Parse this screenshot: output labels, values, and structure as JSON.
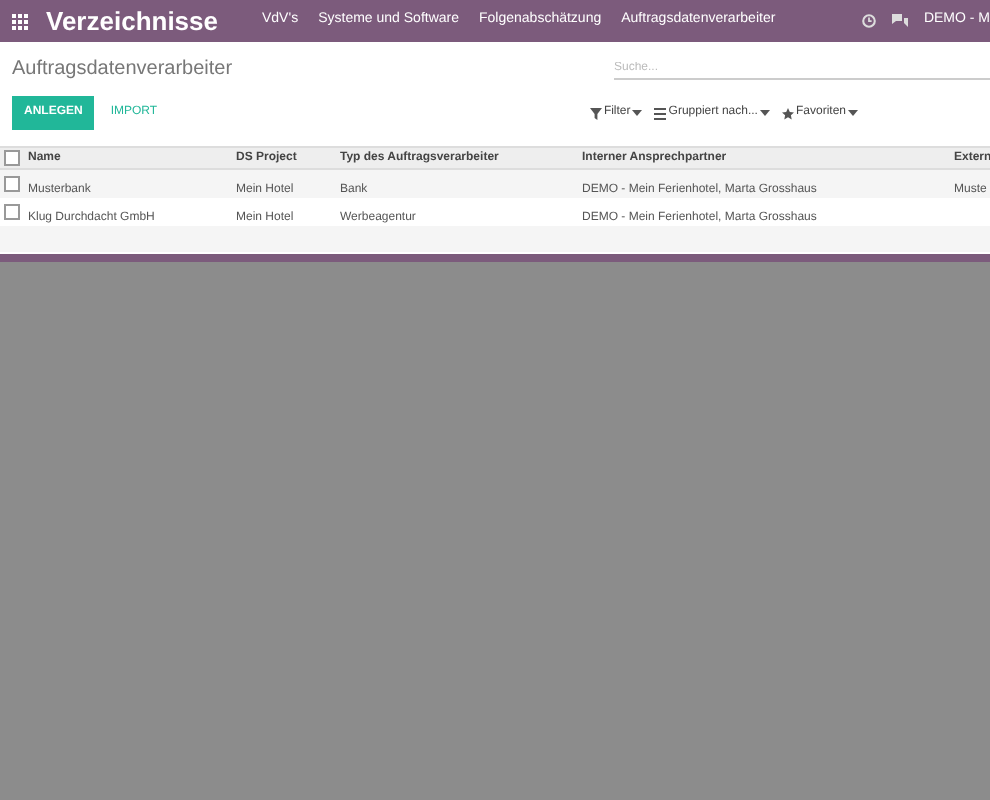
{
  "navbar": {
    "app_title": "Verzeichnisse",
    "menu": [
      "VdV's",
      "Systeme und Software",
      "Folgenabschätzung",
      "Auftragsdatenverarbeiter"
    ],
    "user": "DEMO - M"
  },
  "breadcrumb": "Auftragsdatenverarbeiter",
  "search": {
    "placeholder": "Suche..."
  },
  "buttons": [
    {
      "label": "ANLEGEN",
      "kind": "primary"
    },
    {
      "label": "IMPORT",
      "kind": "link"
    }
  ],
  "filters": [
    "Filter",
    "Gruppiert nach...",
    "Favoriten"
  ],
  "table": {
    "select_all_checked": false,
    "columns": [
      "Name",
      "DS Project",
      "Typ des Auftragsverarbeiter",
      "Interner Ansprechpartner",
      "Extern"
    ],
    "rows": [
      {
        "checked": false,
        "cells": [
          "Musterbank",
          "Mein Hotel",
          "Bank",
          "DEMO - Mein Ferienhotel, Marta Grosshaus",
          "Muste"
        ]
      },
      {
        "checked": false,
        "cells": [
          "Klug Durchdacht GmbH",
          "Mein Hotel",
          "Werbeagentur",
          "DEMO - Mein Ferienhotel, Marta Grosshaus",
          ""
        ]
      }
    ]
  }
}
